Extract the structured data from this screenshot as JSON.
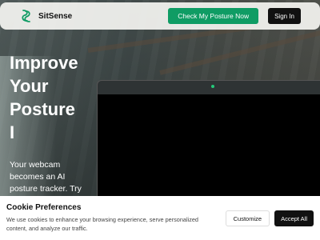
{
  "navbar": {
    "brand": "SitSense",
    "cta_label": "Check My Posture Now",
    "signin_label": "Sign In"
  },
  "hero": {
    "title_lines": [
      "Improve",
      "Your",
      "Posture",
      "I"
    ],
    "subtitle_lines": [
      "Your webcam",
      "becomes an AI",
      "posture tracker. Try"
    ]
  },
  "cookie_banner": {
    "title": "Cookie Preferences",
    "text": "We use cookies to enhance your browsing experience, serve personalized content, and analyze our traffic.",
    "customize_label": "Customize",
    "accept_label": "Accept All"
  },
  "colors": {
    "accent": "#0f9c64",
    "dark": "#111111",
    "camera_indicator": "#25c97a"
  }
}
